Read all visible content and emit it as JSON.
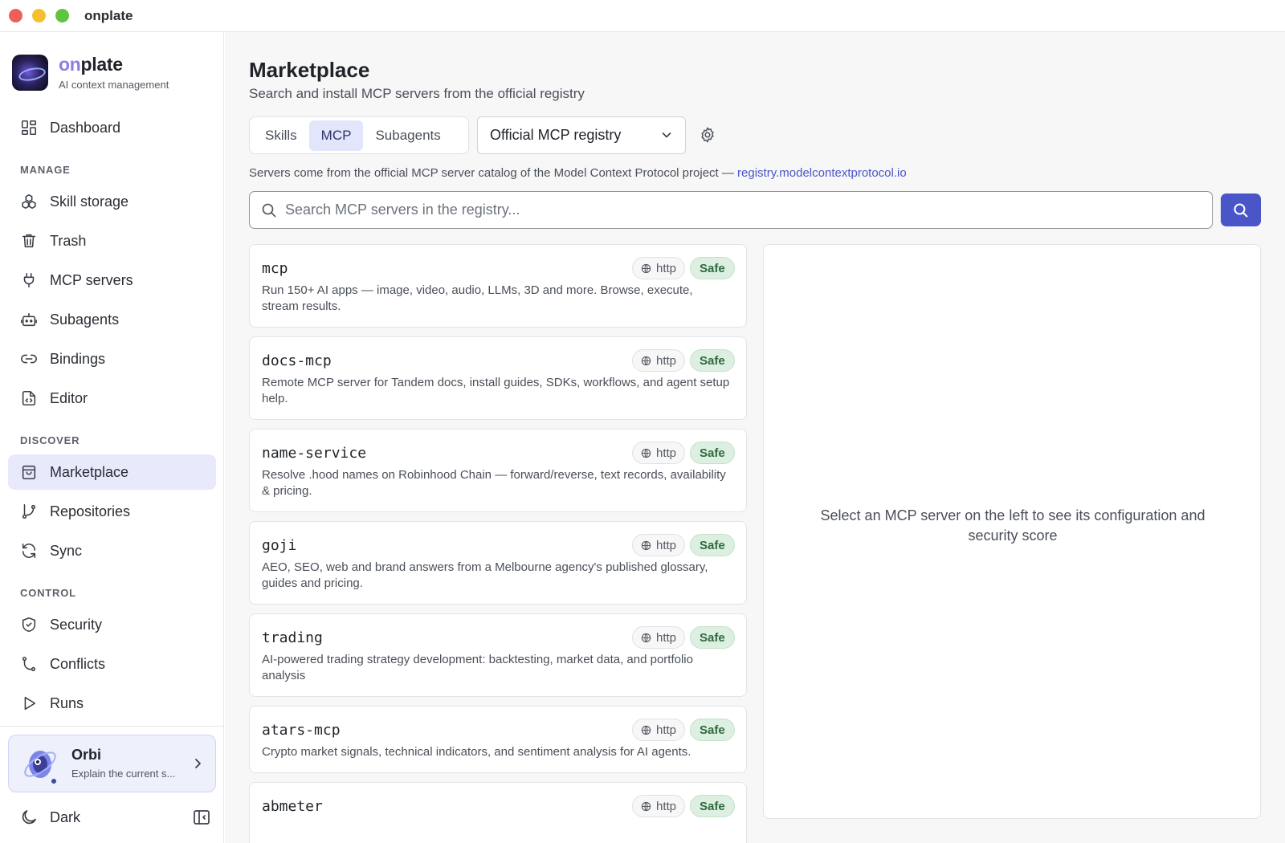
{
  "window": {
    "title": "onplate"
  },
  "brand": {
    "name_accent": "on",
    "name_rest": "plate",
    "subtitle": "AI context management"
  },
  "sidebar": {
    "dashboard": "Dashboard",
    "manage_label": "MANAGE",
    "manage": [
      "Skill storage",
      "Trash",
      "MCP servers",
      "Subagents",
      "Bindings",
      "Editor"
    ],
    "discover_label": "DISCOVER",
    "discover": [
      "Marketplace",
      "Repositories",
      "Sync"
    ],
    "control_label": "CONTROL",
    "control": [
      "Security",
      "Conflicts",
      "Runs"
    ],
    "active_item": "Marketplace"
  },
  "assistant": {
    "name": "Orbi",
    "subtitle": "Explain the current s..."
  },
  "theme": {
    "label": "Dark"
  },
  "main": {
    "title": "Marketplace",
    "subtitle": "Search and install MCP servers from the official registry",
    "tabs": [
      "Skills",
      "MCP",
      "Subagents"
    ],
    "active_tab": "MCP",
    "registry_select": "Official MCP registry",
    "info_text": "Servers come from the official MCP server catalog of the Model Context Protocol project — ",
    "info_link": "registry.modelcontextprotocol.io",
    "search_placeholder": "Search MCP servers in the registry...",
    "detail_empty": "Select an MCP server on the left to see its configuration and security score"
  },
  "servers": [
    {
      "name": "mcp",
      "transport": "http",
      "status": "Safe",
      "description": "Run 150+ AI apps — image, video, audio, LLMs, 3D and more. Browse, execute, stream results."
    },
    {
      "name": "docs-mcp",
      "transport": "http",
      "status": "Safe",
      "description": "Remote MCP server for Tandem docs, install guides, SDKs, workflows, and agent setup help."
    },
    {
      "name": "name-service",
      "transport": "http",
      "status": "Safe",
      "description": "Resolve .hood names on Robinhood Chain — forward/reverse, text records, availability & pricing."
    },
    {
      "name": "goji",
      "transport": "http",
      "status": "Safe",
      "description": "AEO, SEO, web and brand answers from a Melbourne agency's published glossary, guides and pricing."
    },
    {
      "name": "trading",
      "transport": "http",
      "status": "Safe",
      "description": "AI-powered trading strategy development: backtesting, market data, and portfolio analysis"
    },
    {
      "name": "atars-mcp",
      "transport": "http",
      "status": "Safe",
      "description": "Crypto market signals, technical indicators, and sentiment analysis for AI agents."
    },
    {
      "name": "abmeter",
      "transport": "http",
      "status": "Safe",
      "description": ""
    }
  ],
  "colors": {
    "accent": "#4a55c7",
    "safe_bg": "#dcefe1",
    "safe_text": "#2e6b3f",
    "active_nav": "#e8e9fb"
  }
}
